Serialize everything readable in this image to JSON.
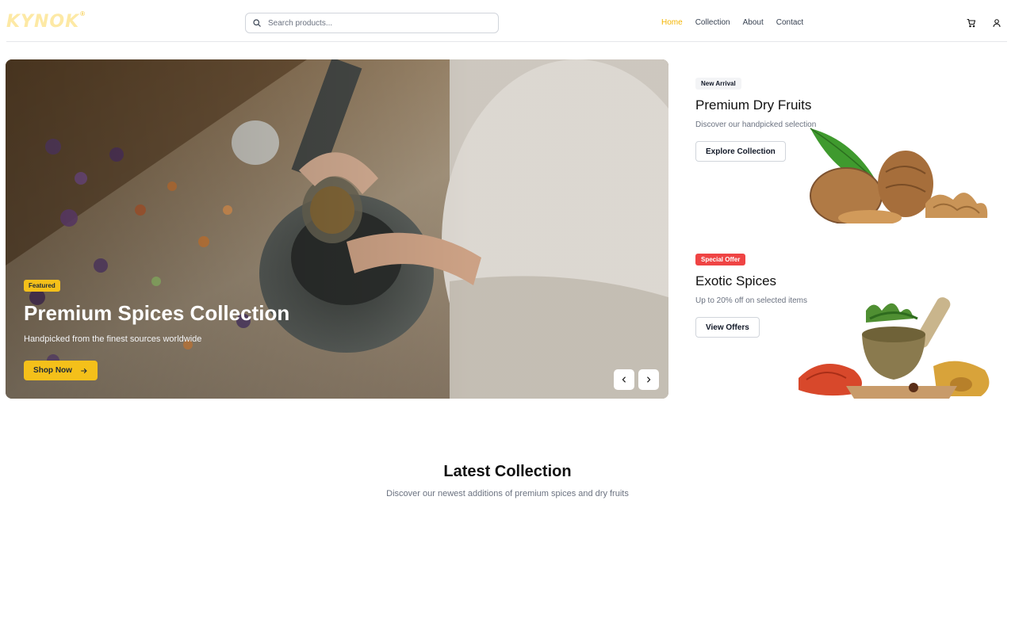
{
  "brand": {
    "name": "KYNOK",
    "reg_mark": "®",
    "color": "#fde9a5"
  },
  "search": {
    "placeholder": "Search products..."
  },
  "nav": {
    "items": [
      {
        "label": "Home",
        "active": true
      },
      {
        "label": "Collection",
        "active": false
      },
      {
        "label": "About",
        "active": false
      },
      {
        "label": "Contact",
        "active": false
      }
    ]
  },
  "header_icons": [
    "cart-icon",
    "user-icon"
  ],
  "hero": {
    "badge": "Featured",
    "title": "Premium Spices Collection",
    "subtitle": "Handpicked from the finest sources worldwide",
    "cta": "Shop Now",
    "prev_icon": "chevron-left-icon",
    "next_icon": "chevron-right-icon"
  },
  "promos": [
    {
      "badge": "New Arrival",
      "title": "Premium Dry Fruits",
      "description": "Discover our handpicked selection",
      "cta": "Explore Collection"
    },
    {
      "badge": "Special Offer",
      "title": "Exotic Spices",
      "description": "Up to 20% off on selected items",
      "cta": "View Offers"
    }
  ],
  "latest": {
    "title": "Latest Collection",
    "subtitle": "Discover our newest additions of premium spices and dry fruits"
  },
  "colors": {
    "accent": "#f4c01a",
    "offer": "#ef4444",
    "nav_active": "#f4b400"
  }
}
